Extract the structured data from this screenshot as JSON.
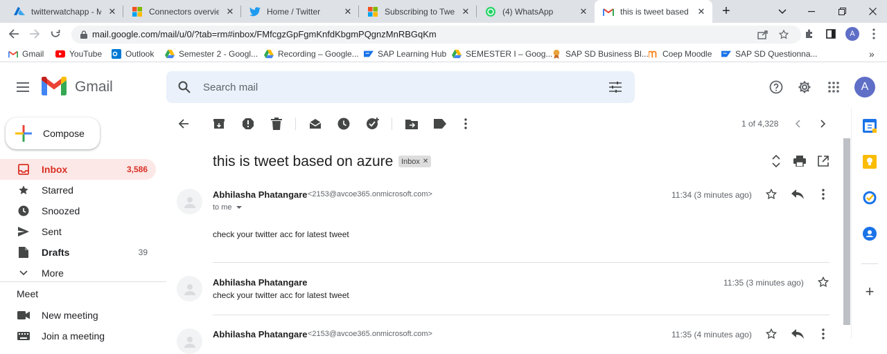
{
  "browser": {
    "tabs": [
      {
        "title": "twitterwatchapp - Mic",
        "icon": "azure-icon"
      },
      {
        "title": "Connectors overview |",
        "icon": "microsoft-icon"
      },
      {
        "title": "Home / Twitter",
        "icon": "twitter-icon"
      },
      {
        "title": "Subscribing to Tweets",
        "icon": "microsoft-icon"
      },
      {
        "title": "(4) WhatsApp",
        "icon": "whatsapp-icon"
      },
      {
        "title": "this is tweet based on",
        "icon": "gmail-icon"
      }
    ],
    "url": "mail.google.com/mail/u/0/?tab=rm#inbox/FMfcgzGpFgmKnfdKbgmPQgnzMnRBGqKm",
    "profile_initial": "A",
    "bookmarks": [
      "Gmail",
      "YouTube",
      "Outlook",
      "Semester 2 - Googl...",
      "Recording – Google...",
      "SAP Learning Hub",
      "SEMESTER I – Goog...",
      "SAP SD Business Bl...",
      "Coep Moodle",
      "SAP SD Questionna..."
    ]
  },
  "gmail": {
    "logo_text": "Gmail",
    "search_placeholder": "Search mail",
    "avatar_initial": "A",
    "compose": "Compose",
    "nav": [
      {
        "label": "Inbox",
        "count": "3,586"
      },
      {
        "label": "Starred",
        "count": ""
      },
      {
        "label": "Snoozed",
        "count": ""
      },
      {
        "label": "Sent",
        "count": ""
      },
      {
        "label": "Drafts",
        "count": "39"
      },
      {
        "label": "More",
        "count": ""
      }
    ],
    "meet": {
      "heading": "Meet",
      "new_meeting": "New meeting",
      "join_meeting": "Join a meeting"
    },
    "pagination": "1 of 4,328",
    "subject": "this is tweet based on azure",
    "label_chip": "Inbox",
    "messages": [
      {
        "sender": "Abhilasha Phatangare",
        "email": "<2153@avcoe365.onmicrosoft.com>",
        "time": "11:34 (3 minutes ago)",
        "to": "to me",
        "body": "check your twitter acc for latest tweet"
      },
      {
        "sender": "Abhilasha Phatangare",
        "time": "11:35 (3 minutes ago)",
        "snippet": "check your twitter acc for latest tweet"
      },
      {
        "sender": "Abhilasha Phatangare",
        "email": "<2153@avcoe365.onmicrosoft.com>",
        "time": "11:35 (4 minutes ago)"
      }
    ],
    "colors": {
      "red": "#d93025",
      "blue": "#1a73e8",
      "inbox_bg": "#fce8e6",
      "avatar": "#5f6fc7"
    }
  }
}
